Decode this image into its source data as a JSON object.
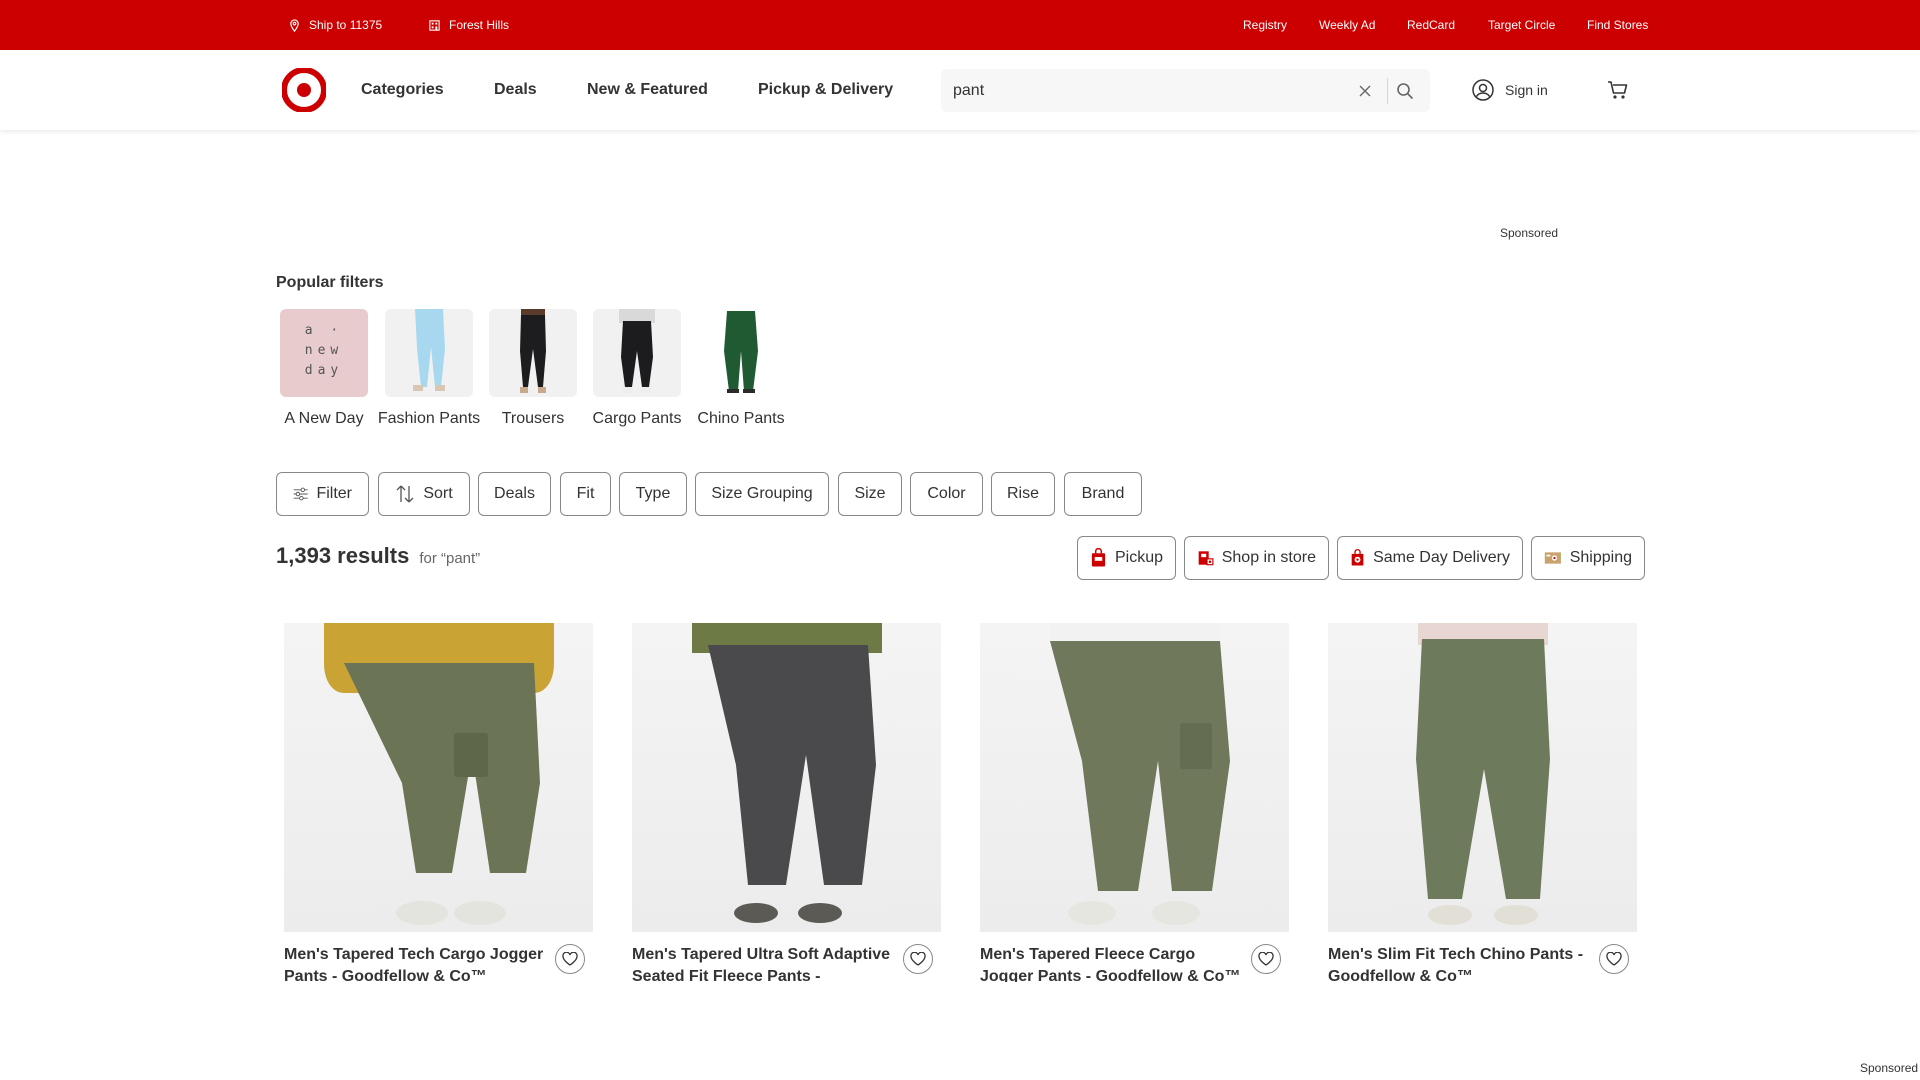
{
  "top_bar": {
    "ship_to": "Ship to 11375",
    "store": "Forest Hills",
    "links": [
      "Registry",
      "Weekly Ad",
      "RedCard",
      "Target Circle",
      "Find Stores"
    ]
  },
  "header": {
    "nav": [
      "Categories",
      "Deals",
      "New & Featured",
      "Pickup & Delivery"
    ],
    "search_value": "pant",
    "sign_in": "Sign in",
    "icons": [
      "target-logo",
      "clear-icon",
      "search-icon",
      "account-icon",
      "cart-icon"
    ]
  },
  "sponsored_label": "Sponsored",
  "popular_filters": {
    "title": "Popular filters",
    "items": [
      "A New Day",
      "Fashion Pants",
      "Trousers",
      "Cargo Pants",
      "Chino Pants"
    ],
    "brand_logo_text": "a · new day"
  },
  "filter_chips": [
    "Filter",
    "Sort",
    "Deals",
    "Fit",
    "Type",
    "Size Grouping",
    "Size",
    "Color",
    "Rise",
    "Brand"
  ],
  "results": {
    "count": "1,393 results",
    "query_text": "for “pant”"
  },
  "fulfillment_chips": [
    "Pickup",
    "Shop in store",
    "Same Day Delivery",
    "Shipping"
  ],
  "products": [
    {
      "title": "Men's Tapered Tech Cargo Jogger Pants - Goodfellow & Co™"
    },
    {
      "title": "Men's Tapered Ultra Soft Adaptive Seated Fit Fleece Pants - Goodfellow & Co™"
    },
    {
      "title": "Men's Tapered Fleece Cargo Jogger Pants - Goodfellow & Co™"
    },
    {
      "title": "Men's Slim Fit Tech Chino Pants - Goodfellow & Co™"
    }
  ],
  "colors": {
    "brand_red": "#cc0000",
    "product_pants": [
      "#6b7555",
      "#4a4a4c",
      "#70785c",
      "#6e7a5c"
    ],
    "product_shirts": [
      "#c9a334",
      "#6d7a45",
      "#f2f2f2",
      "#e8d6d2"
    ]
  }
}
